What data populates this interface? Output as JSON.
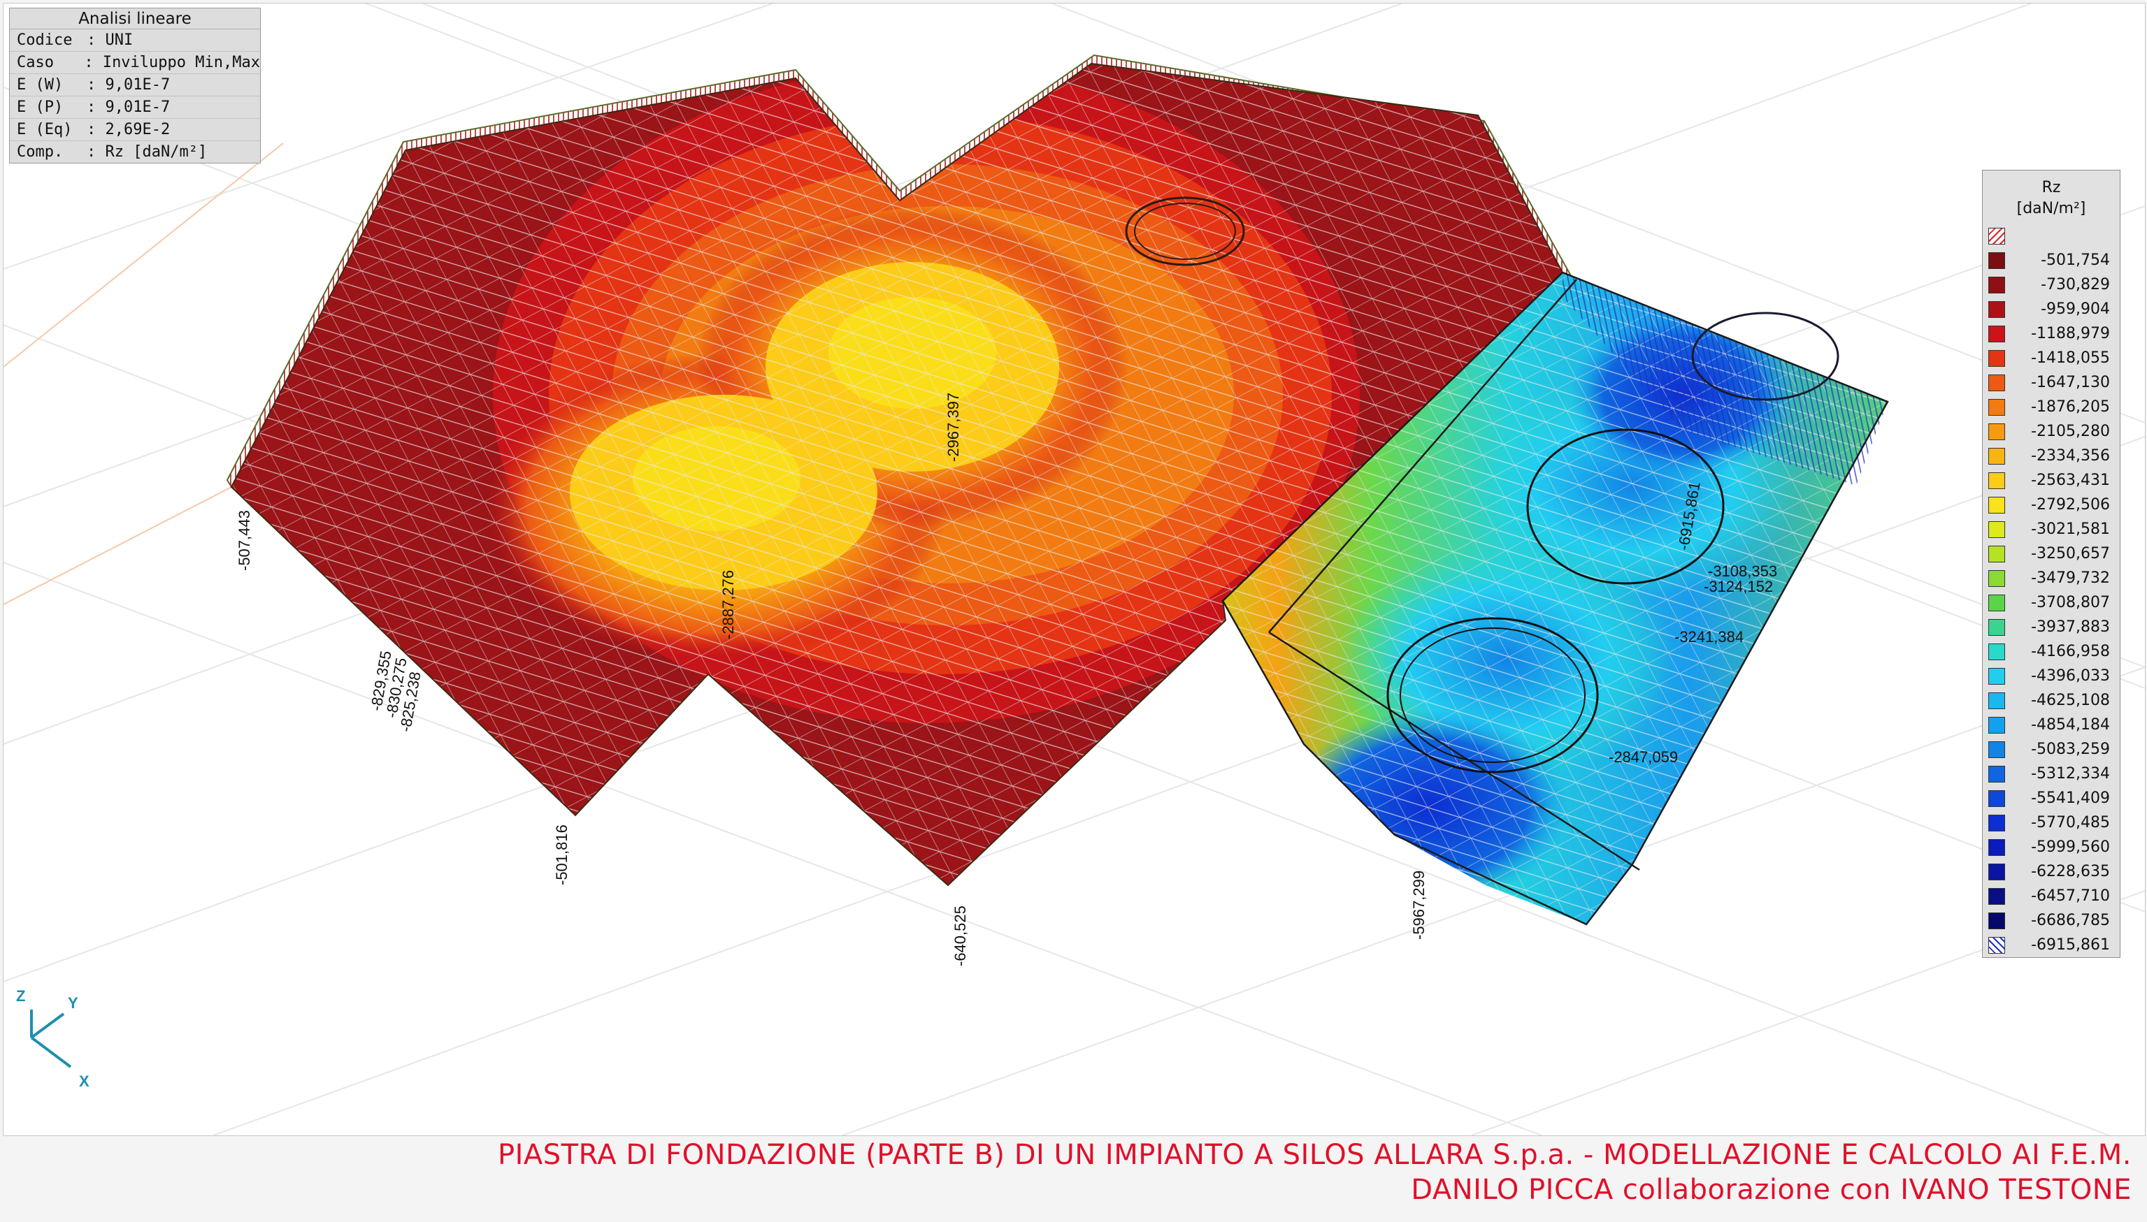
{
  "info": {
    "title": "Analisi lineare",
    "rows": [
      {
        "key": "Codice",
        "value": ": UNI"
      },
      {
        "key": "Caso",
        "value": ": Inviluppo Min,Max"
      },
      {
        "key": "E (W)",
        "value": ": 9,01E-7"
      },
      {
        "key": "E (P)",
        "value": ": 9,01E-7"
      },
      {
        "key": "E (Eq)",
        "value": ": 2,69E-2"
      },
      {
        "key": "Comp.",
        "value": ": Rz [daN/m²]"
      }
    ]
  },
  "legend": {
    "title": "Rz",
    "unit": "[daN/m²]",
    "top_swatch": "hatch-red",
    "bottom_swatch": "hatch-blue",
    "items": [
      {
        "value": "-501,754",
        "color": "#7a0f12"
      },
      {
        "value": "-730,829",
        "color": "#900f14"
      },
      {
        "value": "-959,904",
        "color": "#ac1215"
      },
      {
        "value": "-1188,979",
        "color": "#cc1418"
      },
      {
        "value": "-1418,055",
        "color": "#e43414"
      },
      {
        "value": "-1647,130",
        "color": "#ec5a14"
      },
      {
        "value": "-1876,205",
        "color": "#f27c12"
      },
      {
        "value": "-2105,280",
        "color": "#f69a10"
      },
      {
        "value": "-2334,356",
        "color": "#f8b412"
      },
      {
        "value": "-2563,431",
        "color": "#fccc18"
      },
      {
        "value": "-2792,506",
        "color": "#fae21c"
      },
      {
        "value": "-3021,581",
        "color": "#dcea1e"
      },
      {
        "value": "-3250,657",
        "color": "#b6e226"
      },
      {
        "value": "-3479,732",
        "color": "#8cda32"
      },
      {
        "value": "-3708,807",
        "color": "#5cd44a"
      },
      {
        "value": "-3937,883",
        "color": "#3ad490"
      },
      {
        "value": "-4166,958",
        "color": "#2ad8cc"
      },
      {
        "value": "-4396,033",
        "color": "#22cdf0"
      },
      {
        "value": "-4625,108",
        "color": "#1ab8f0"
      },
      {
        "value": "-4854,184",
        "color": "#14a0ec"
      },
      {
        "value": "-5083,259",
        "color": "#1284e6"
      },
      {
        "value": "-5312,334",
        "color": "#1066e0"
      },
      {
        "value": "-5541,409",
        "color": "#0e48d8"
      },
      {
        "value": "-5770,485",
        "color": "#0c2ed2"
      },
      {
        "value": "-5999,560",
        "color": "#0a1cbc"
      },
      {
        "value": "-6228,635",
        "color": "#0a14a0"
      },
      {
        "value": "-6457,710",
        "color": "#080e86"
      },
      {
        "value": "-6686,785",
        "color": "#06086a"
      },
      {
        "value": "-6915,861",
        "color": "#ffffff"
      }
    ]
  },
  "mesh_labels": [
    {
      "text": "-507,443"
    },
    {
      "text": "-829,355"
    },
    {
      "text": "-830,275"
    },
    {
      "text": "-825,238"
    },
    {
      "text": "-501,816"
    },
    {
      "text": "-640,525"
    },
    {
      "text": "-2887,276"
    },
    {
      "text": "-2967,397"
    },
    {
      "text": "-5967,299"
    },
    {
      "text": "-6915,861"
    },
    {
      "text": "-3108,353"
    },
    {
      "text": "-3124,152"
    },
    {
      "text": "-3241,384"
    },
    {
      "text": "-2847,059"
    }
  ],
  "axes": {
    "z": "Z",
    "y": "Y",
    "x": "X"
  },
  "footer": {
    "line1": "PIASTRA DI FONDAZIONE (PARTE B) DI UN IMPIANTO A SILOS ALLARA S.p.a. - MODELLAZIONE E CALCOLO AI F.E.M.",
    "line2": "DANILO PICCA collaborazione con IVANO TESTONE"
  },
  "colors": {
    "footer_text": "#e0102a",
    "mesh_lines": "#d8d8d8",
    "grid_lines": "#e6e6e6"
  }
}
